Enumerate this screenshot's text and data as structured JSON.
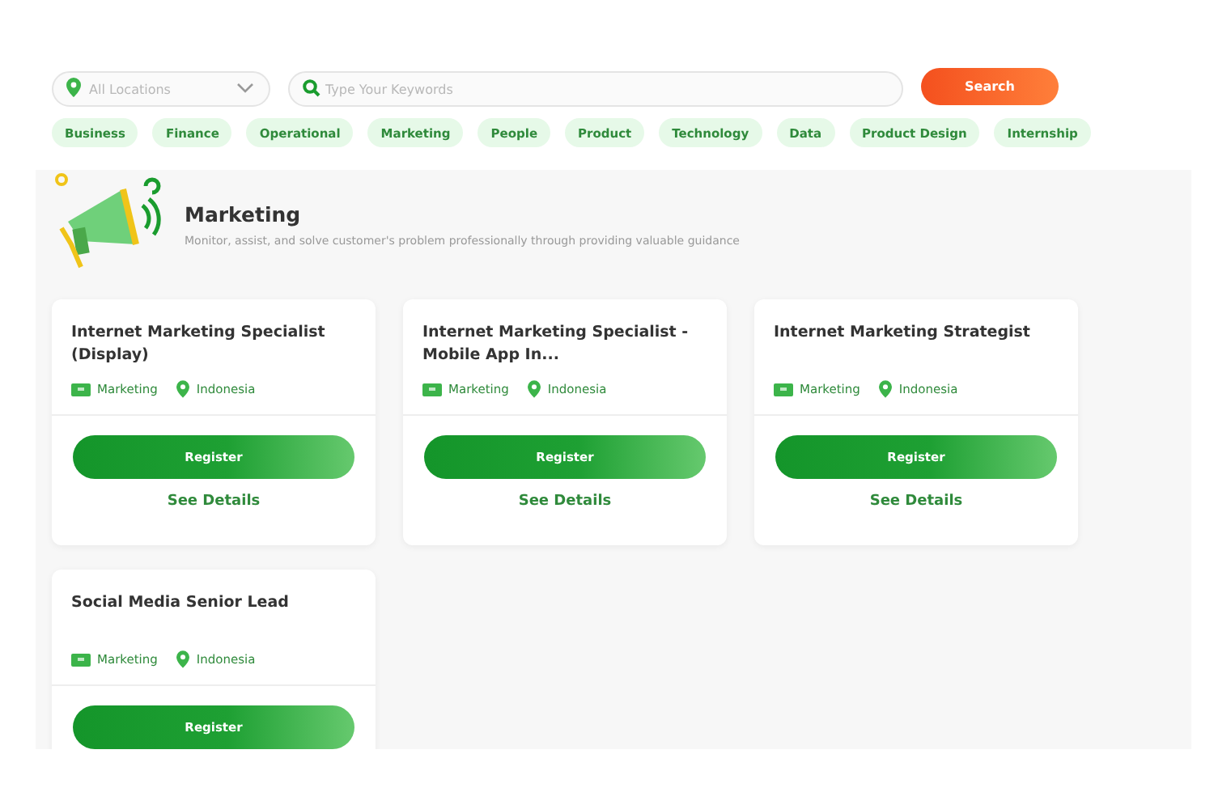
{
  "search_bar": {
    "location": {
      "placeholder": "All Locations"
    },
    "keywords": {
      "placeholder": "Type Your Keywords"
    },
    "button": "Search"
  },
  "categories": [
    "Business",
    "Finance",
    "Operational",
    "Marketing",
    "People",
    "Product",
    "Technology",
    "Data",
    "Product Design",
    "Internship"
  ],
  "section": {
    "title": "Marketing",
    "description": "Monitor, assist, and solve customer's problem professionally through providing valuable guidance"
  },
  "jobs": [
    {
      "title": "Internet Marketing Specialist (Display)",
      "department": "Marketing",
      "location": "Indonesia",
      "register": "Register",
      "details": "See Details"
    },
    {
      "title": "Internet Marketing Specialist - Mobile App In...",
      "department": "Marketing",
      "location": "Indonesia",
      "register": "Register",
      "details": "See Details"
    },
    {
      "title": "Internet Marketing Strategist",
      "department": "Marketing",
      "location": "Indonesia",
      "register": "Register",
      "details": "See Details"
    },
    {
      "title": "Social Media Senior Lead",
      "department": "Marketing",
      "location": "Indonesia",
      "register": "Register"
    }
  ]
}
